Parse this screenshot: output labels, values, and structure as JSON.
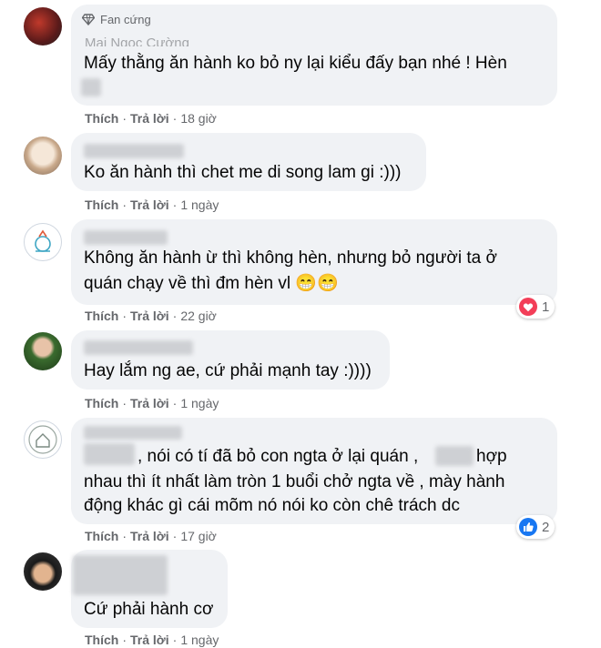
{
  "actions": {
    "like": "Thích",
    "reply": "Trả lời",
    "separator": "·"
  },
  "comments": [
    {
      "badge": "Fan cứng",
      "author": "Mai Ngọc Cường",
      "lines": [
        "Mấy thằng ăn hành ko bỏ ny lại kiểu đấy bạn nhé ! Hèn"
      ],
      "time": "18 giờ"
    },
    {
      "author": "",
      "lines": [
        "Ko ăn hành thì chet me di song lam gi :)))"
      ],
      "time": "1 ngày"
    },
    {
      "author": "",
      "lines": [
        "Không ăn hành ừ thì không hèn, nhưng bỏ người ta ở",
        "quán chạy về thì đm hèn vl 😁😁"
      ],
      "time": "22 giờ",
      "reaction": {
        "icon": "heart-reaction-icon",
        "count": "1"
      }
    },
    {
      "author": "",
      "lines": [
        "Hay lắm ng ae, cứ phải mạnh tay :))))"
      ],
      "time": "1 ngày"
    },
    {
      "author": "",
      "lines": [
        ", nói có tí đã bỏ con ngta ở lại quán ,",
        "hợp",
        "nhau thì ít nhất làm tròn 1 buổi chở ngta về , mày hành",
        "động khác gì cái mõm nó nói ko còn chê trách dc"
      ],
      "time": "17 giờ",
      "reaction": {
        "icon": "like-reaction-icon",
        "count": "2"
      }
    },
    {
      "author": "",
      "lines": [
        "Cứ phải hành cơ"
      ],
      "time": "1 ngày"
    }
  ],
  "colors": {
    "bubble": "#f0f2f5",
    "meta_text": "#65676b",
    "heart_red": "#f33e58",
    "like_blue": "#1877f2"
  }
}
